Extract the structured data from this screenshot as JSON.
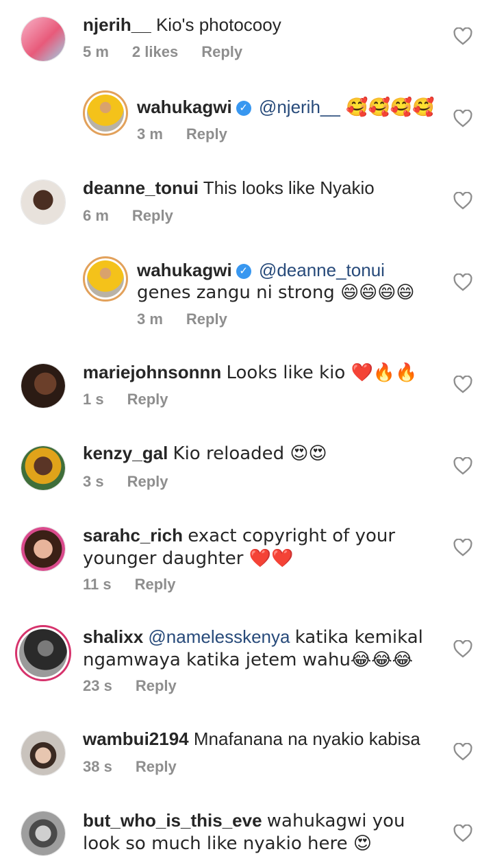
{
  "comments": [
    {
      "user": "njerih__",
      "text": "Kio's photocooy",
      "time": "5 m",
      "likes": "2 likes",
      "reply": "Reply",
      "avatar_icon": "avatar-njerih"
    },
    {
      "user": "wahukagwi",
      "mention": "@njerih__",
      "text": " 🥰🥰🥰🥰",
      "time": "3 m",
      "reply": "Reply",
      "verified": true,
      "avatar_icon": "avatar-wahukagwi"
    },
    {
      "user": "deanne_tonui",
      "text": "This looks like Nyakio",
      "time": "6 m",
      "reply": "Reply",
      "avatar_icon": "avatar-deanne"
    },
    {
      "user": "wahukagwi",
      "mention": "@deanne_tonui",
      "text": "genes zangu ni strong 😄😄😄😄",
      "time": "3 m",
      "reply": "Reply",
      "verified": true,
      "avatar_icon": "avatar-wahukagwi"
    },
    {
      "user": "mariejohnsonnn",
      "text": "Looks like kio ❤️🔥🔥",
      "time": "1 s",
      "reply": "Reply",
      "avatar_icon": "avatar-marie"
    },
    {
      "user": "kenzy_gal",
      "text": "Kio reloaded 😍😍",
      "time": "3 s",
      "reply": "Reply",
      "avatar_icon": "avatar-kenzy"
    },
    {
      "user": "sarahc_rich",
      "text": "exact copyright of your younger daughter ❤️❤️",
      "time": "11 s",
      "reply": "Reply",
      "avatar_icon": "avatar-sarah"
    },
    {
      "user": "shalixx",
      "mention": "@namelesskenya",
      "text": "katika kemikal ngamwaya katika jetem wahu😂😂😂",
      "time": "23 s",
      "reply": "Reply",
      "avatar_icon": "avatar-shalixx"
    },
    {
      "user": "wambui2194",
      "text": "Mnafanana na nyakio kabisa",
      "time": "38 s",
      "reply": "Reply",
      "avatar_icon": "avatar-wambui"
    },
    {
      "user": "but_who_is_this_eve",
      "text": "wahukagwi you look so much like nyakio here 😍",
      "avatar_icon": "avatar-eve"
    }
  ],
  "verified_glyph": "✓",
  "heart_icon": "heart-outline-icon"
}
